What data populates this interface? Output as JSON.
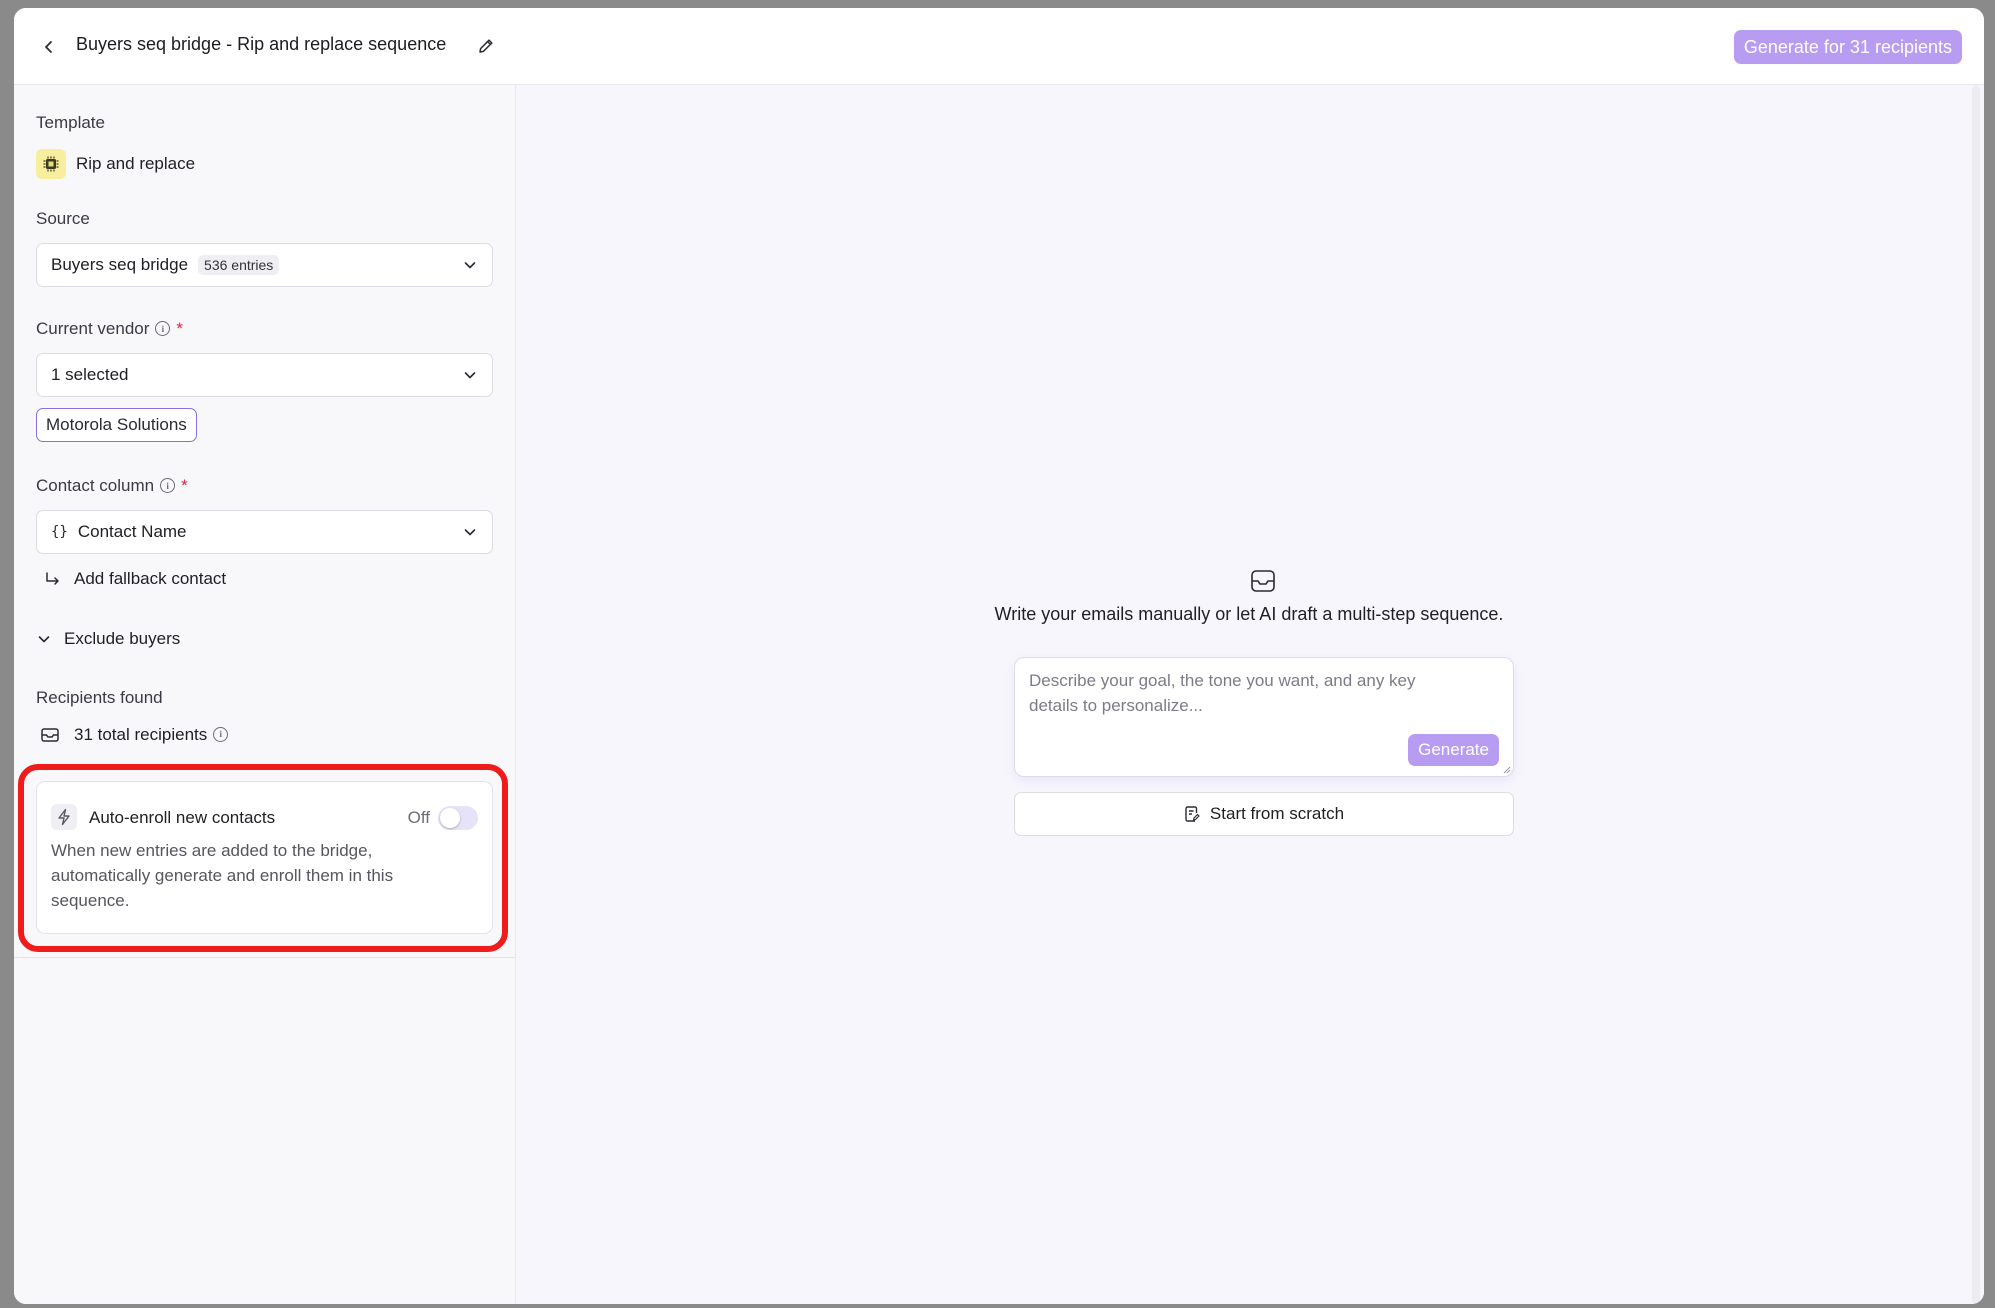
{
  "header": {
    "title": "Buyers seq bridge - Rip and replace sequence",
    "generate_button": "Generate for 31 recipients"
  },
  "sidebar": {
    "template_label": "Template",
    "template_value": "Rip and replace",
    "source_label": "Source",
    "source_value": "Buyers seq bridge",
    "source_badge": "536 entries",
    "vendor_label": "Current vendor",
    "vendor_value": "1 selected",
    "vendor_chip": "Motorola Solutions",
    "contact_label": "Contact column",
    "contact_value": "Contact Name",
    "fallback_link": "Add fallback contact",
    "exclude_label": "Exclude buyers",
    "recipients_label": "Recipients found",
    "recipients_value": "31 total recipients",
    "auto_enroll": {
      "title": "Auto-enroll new contacts",
      "state": "Off",
      "description": "When new entries are added to the bridge, automatically generate and enroll them in this sequence."
    }
  },
  "main": {
    "empty_text": "Write your emails manually or let AI draft a multi-step sequence.",
    "prompt_placeholder": "Describe your goal, the tone you want, and any key details to personalize...",
    "generate_label": "Generate",
    "scratch_label": "Start from scratch"
  },
  "colors": {
    "accent": "#b79cf2",
    "chip_border": "#8b6ee0",
    "highlight": "#ef1c1c",
    "required": "#e0224a"
  }
}
